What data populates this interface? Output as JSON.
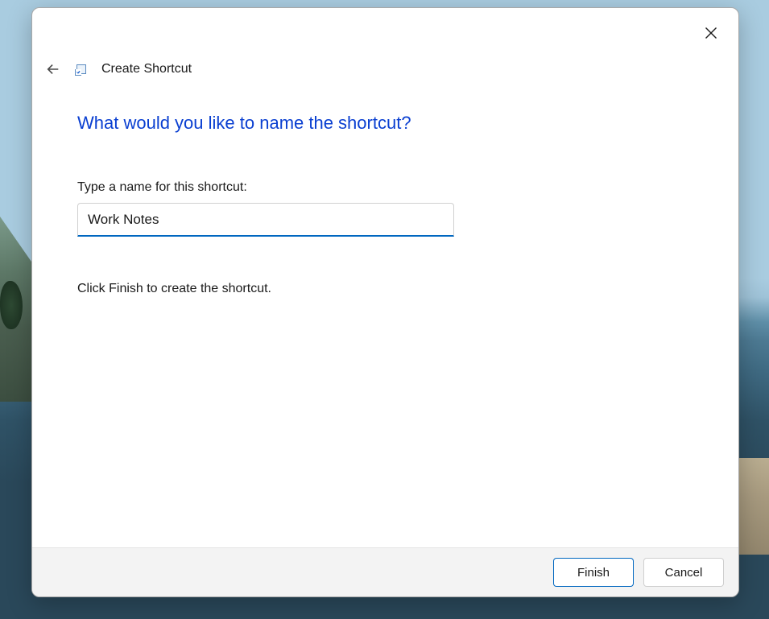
{
  "dialog": {
    "title": "Create Shortcut",
    "heading": "What would you like to name the shortcut?",
    "field_label": "Type a name for this shortcut:",
    "input_value": "Work Notes",
    "instruction": "Click Finish to create the shortcut.",
    "buttons": {
      "finish": "Finish",
      "cancel": "Cancel"
    }
  }
}
